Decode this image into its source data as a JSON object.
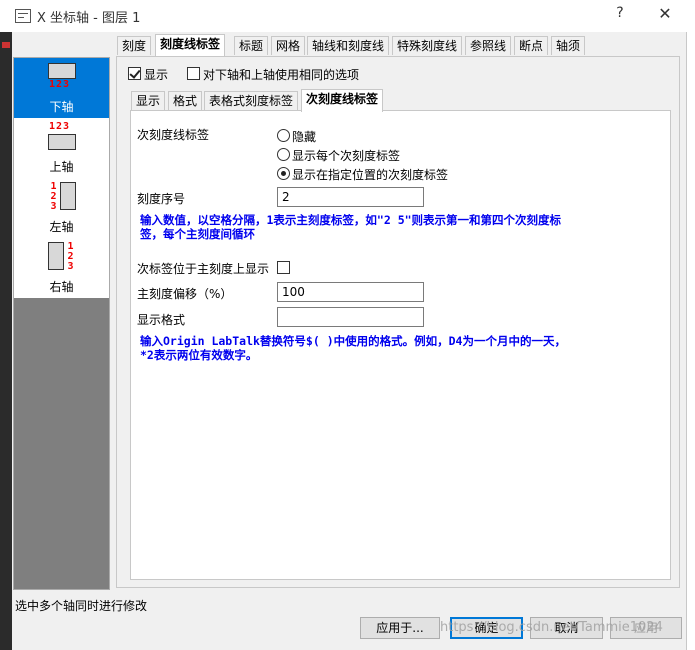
{
  "window": {
    "title": "X 坐标轴 - 图层 1",
    "help_glyph": "?",
    "close_glyph": "✕"
  },
  "main_tabs": [
    {
      "label": "刻度"
    },
    {
      "label": "刻度线标签",
      "active": true
    },
    {
      "label": "标题"
    },
    {
      "label": "网格"
    },
    {
      "label": "轴线和刻度线"
    },
    {
      "label": "特殊刻度线"
    },
    {
      "label": "参照线"
    },
    {
      "label": "断点"
    },
    {
      "label": "轴须"
    }
  ],
  "axes": [
    {
      "label": "下轴",
      "numbers": "123",
      "selected": true
    },
    {
      "label": "上轴",
      "numbers": "123"
    },
    {
      "label": "左轴",
      "numbers": "123"
    },
    {
      "label": "右轴",
      "numbers": "123"
    }
  ],
  "top_options": {
    "show_label": "显示",
    "show_checked": true,
    "same_options_label": "对下轴和上轴使用相同的选项",
    "same_options_checked": false
  },
  "sub_tabs": [
    {
      "label": "显示"
    },
    {
      "label": "格式"
    },
    {
      "label": "表格式刻度标签"
    },
    {
      "label": "次刻度线标签",
      "active": true
    }
  ],
  "minor_labels": {
    "section_label": "次刻度线标签",
    "options": [
      {
        "label": "隐藏",
        "checked": false
      },
      {
        "label": "显示每个次刻度标签",
        "checked": false
      },
      {
        "label": "显示在指定位置的次刻度标签",
        "checked": true
      }
    ],
    "tick_index_label": "刻度序号",
    "tick_index_value": "2",
    "tick_index_hint_1": "输入数值，以空格分隔，1表示主刻度标签，如\"2 5\"则表示第一和第四个次刻度标",
    "tick_index_hint_2": "签，每个主刻度间循环",
    "show_on_major_label": "次标签位于主刻度上显示",
    "show_on_major_checked": false,
    "major_offset_label": "主刻度偏移（%）",
    "major_offset_value": "100",
    "display_format_label": "显示格式",
    "display_format_value": "",
    "format_hint_1": "输入Origin LabTalk替换符号$( )中使用的格式。例如，D4为一个月中的一天，",
    "format_hint_2": "*2表示两位有效数字。"
  },
  "status": "选中多个轴同时进行修改",
  "buttons": {
    "apply": "应用于...",
    "ok": "确定",
    "cancel": "取消",
    "apply_now": "应用"
  },
  "watermark": "https://blog.csdn.net/Tammie1024",
  "colors": {
    "selection": "#0078d7",
    "hint_text": "#0000ee",
    "glyph_red": "#e00000"
  }
}
